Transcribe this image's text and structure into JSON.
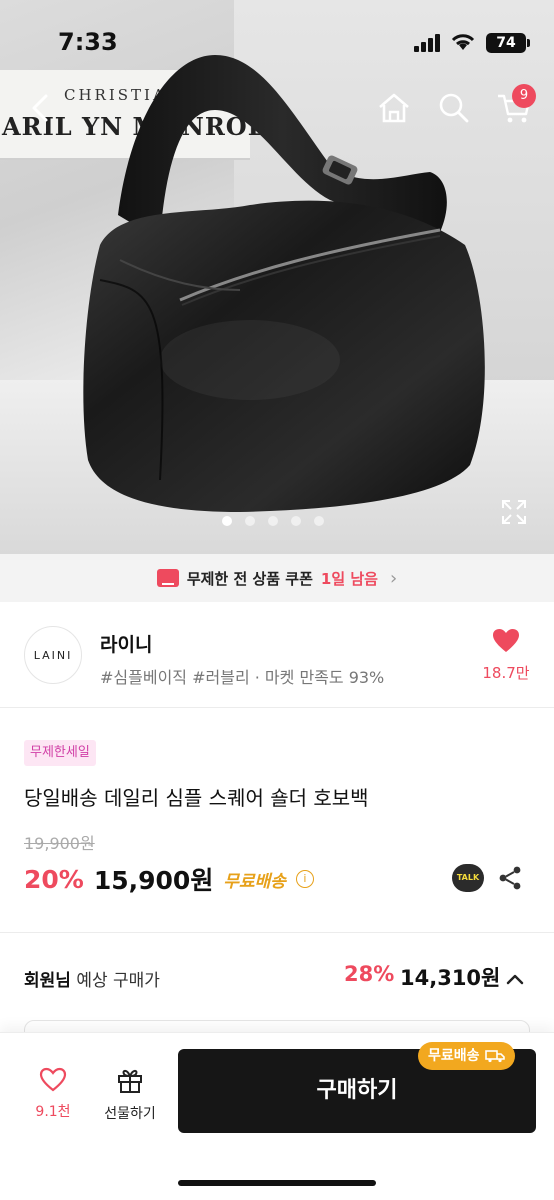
{
  "status_bar": {
    "time": "7:33",
    "battery": "74"
  },
  "hero": {
    "book_title": "CHRISTIANE",
    "book_name": "ARIL YN MONROE",
    "total_images": 5,
    "active_image": 0
  },
  "nav": {
    "cart_count": "9"
  },
  "coupon": {
    "text": "무제한 전 상품 쿠폰",
    "remaining": "1일 남음"
  },
  "shop": {
    "logo_text": "LAINI",
    "name": "라이니",
    "tags": "#심플베이직 #러블리 · 마켓 만족도 93%",
    "likes": "18.7만"
  },
  "product": {
    "badge": "무제한세일",
    "title": "당일배송 데일리 심플 스퀘어 숄더 호보백",
    "original_price": "19,900원",
    "discount": "20%",
    "price": "15,900원",
    "free_shipping": "무료배송",
    "talk_label": "TALK"
  },
  "member": {
    "label_bold": "회원님",
    "label_rest": " 예상 구매가",
    "discount": "28%",
    "price": "14,310원"
  },
  "bottom": {
    "wish_count": "9.1천",
    "gift_label": "선물하기",
    "buy_label": "구매하기",
    "free_pill": "무료배송"
  },
  "colors": {
    "accent": "#ee4a5e",
    "free": "#f2a81f",
    "buy": "#161616"
  }
}
